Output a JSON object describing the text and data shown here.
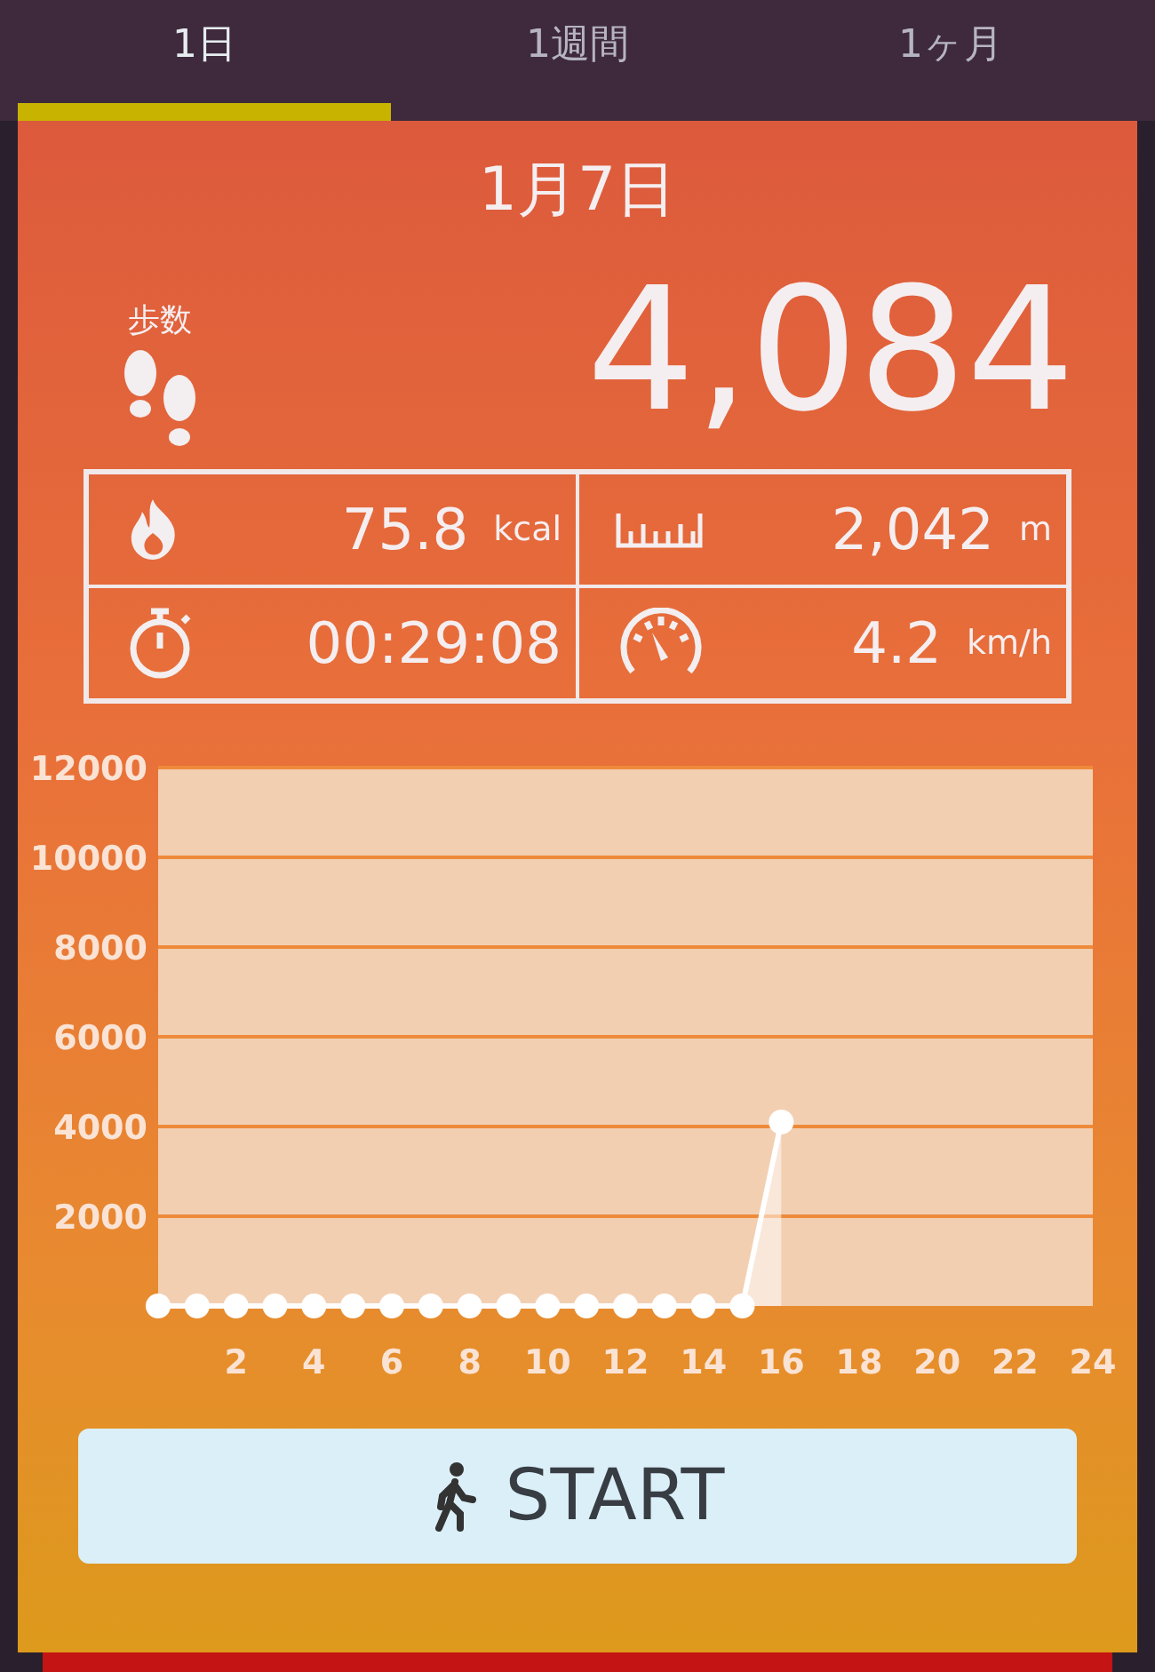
{
  "tabs": [
    {
      "label": "1日",
      "selected": true
    },
    {
      "label": "1週間",
      "selected": false
    },
    {
      "label": "1ヶ月",
      "selected": false
    }
  ],
  "date": "1月7日",
  "steps": {
    "label": "歩数",
    "value": "4,084"
  },
  "stats": [
    {
      "kind": "calories",
      "value": "75.8",
      "unit": "kcal"
    },
    {
      "kind": "distance",
      "value": "2,042",
      "unit": "m"
    },
    {
      "kind": "time",
      "value": "00:29:08"
    },
    {
      "kind": "speed",
      "value": "4.2",
      "unit": "km/h"
    }
  ],
  "chart": {
    "chart_data": {
      "type": "line",
      "x": [
        0,
        1,
        2,
        3,
        4,
        5,
        6,
        7,
        8,
        9,
        10,
        11,
        12,
        13,
        14,
        15,
        16
      ],
      "series": [
        {
          "color": "#ffffff",
          "marker": true,
          "values": [
            0,
            0,
            0,
            0,
            0,
            0,
            0,
            0,
            0,
            0,
            0,
            0,
            0,
            0,
            0,
            0,
            4100
          ]
        }
      ],
      "grid": true,
      "xlim": [
        0,
        24
      ],
      "ylim": [
        0,
        12000
      ],
      "xticks": [
        2,
        4,
        6,
        8,
        10,
        12,
        14,
        16,
        18,
        20,
        22,
        24
      ],
      "yticks": [
        2000,
        4000,
        6000,
        8000,
        10000,
        12000
      ]
    }
  },
  "start_button": {
    "label": "START"
  }
}
